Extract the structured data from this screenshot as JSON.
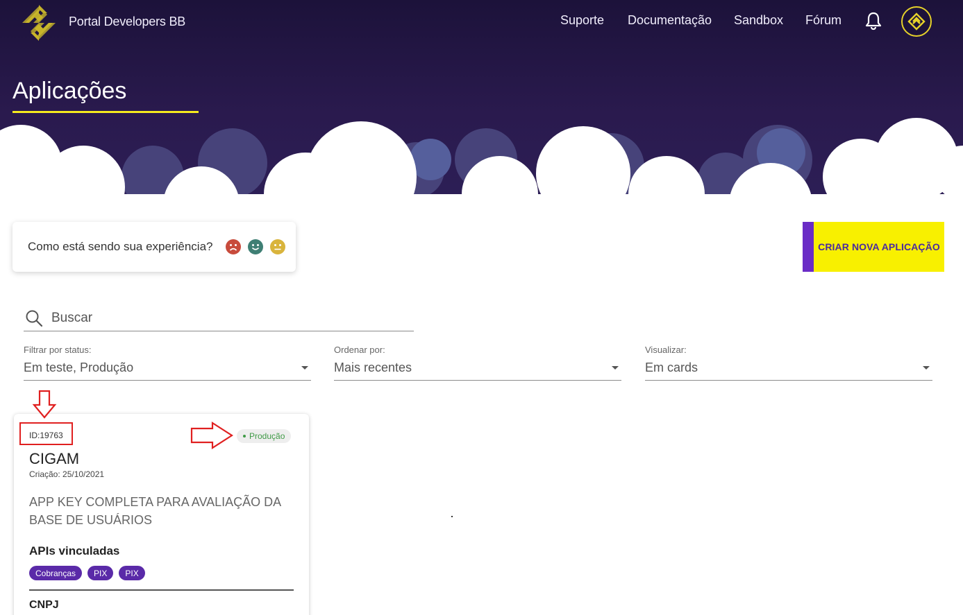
{
  "header": {
    "brand": "Portal Developers BB",
    "nav": [
      {
        "label": "Suporte"
      },
      {
        "label": "Documentação"
      },
      {
        "label": "Sandbox"
      },
      {
        "label": "Fórum"
      }
    ],
    "bell_icon": "bell-icon",
    "avatar_icon": "bb-logo-icon",
    "page_title": "Aplicações"
  },
  "feedback": {
    "question": "Como está sendo sua experiência?",
    "faces": [
      "sad-face-icon",
      "happy-face-icon",
      "neutral-face-icon"
    ]
  },
  "create_button": {
    "label": "CRIAR NOVA APLICAÇÃO"
  },
  "search": {
    "placeholder": "Buscar"
  },
  "filters": [
    {
      "label": "Filtrar por status:",
      "value": "Em teste, Produção"
    },
    {
      "label": "Ordenar por:",
      "value": "Mais recentes"
    },
    {
      "label": "Visualizar:",
      "value": "Em cards"
    }
  ],
  "card": {
    "id": "ID:19763",
    "status": "Produção",
    "name": "CIGAM",
    "created": "Criação: 25/10/2021",
    "description": "APP KEY COMPLETA PARA AVALIAÇÃO DA BASE DE USUÁRIOS",
    "apis_title": "APIs vinculadas",
    "apis": [
      "Cobranças",
      "PIX",
      "PIX"
    ],
    "cnpj_title": "CNPJ"
  },
  "colors": {
    "header_bg": "#2a1a4e",
    "accent_yellow": "#f8f000",
    "accent_purple": "#6a2cc6",
    "tag_purple": "#5a2aa8",
    "status_green": "#3f9a46",
    "annotation_red": "#e02020"
  }
}
